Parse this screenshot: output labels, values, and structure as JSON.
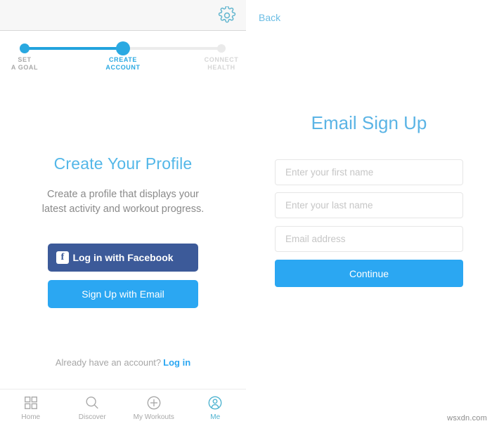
{
  "left_panel": {
    "header": {
      "settings_icon": "gear-icon"
    },
    "stepper": {
      "steps": [
        {
          "label_line1": "SET",
          "label_line2": "A GOAL",
          "state": "complete"
        },
        {
          "label_line1": "CREATE",
          "label_line2": "ACCOUNT",
          "state": "current"
        },
        {
          "label_line1": "CONNECT",
          "label_line2": "HEALTH",
          "state": "upcoming"
        }
      ],
      "active_color": "#2aa9e2",
      "inactive_color": "#eaeaea"
    },
    "title": "Create Your Profile",
    "subtitle_line1": "Create a profile that displays your",
    "subtitle_line2": "latest activity and workout progress.",
    "facebook_button": {
      "label": "Log in with Facebook",
      "icon": "facebook-icon",
      "color": "#3c5a99",
      "badge_letter": "f"
    },
    "email_button": {
      "label": "Sign Up with Email",
      "color": "#2ba7f2"
    },
    "footer": {
      "prompt": "Already have an account?",
      "link": "Log in"
    },
    "tabbar": {
      "items": [
        {
          "label": "Home",
          "icon": "grid-icon",
          "active": false
        },
        {
          "label": "Discover",
          "icon": "search-icon",
          "active": false
        },
        {
          "label": "My Workouts",
          "icon": "plus-circle-icon",
          "active": false
        },
        {
          "label": "Me",
          "icon": "person-circle-icon",
          "active": true
        }
      ],
      "active_color": "#4fb3d0",
      "inactive_color": "#a8a8a8"
    }
  },
  "right_panel": {
    "back_label": "Back",
    "title": "Email Sign Up",
    "fields": [
      {
        "name": "first-name",
        "placeholder": "Enter your first name",
        "value": ""
      },
      {
        "name": "last-name",
        "placeholder": "Enter your last name",
        "value": ""
      },
      {
        "name": "email",
        "placeholder": "Email address",
        "value": ""
      }
    ],
    "continue_button": {
      "label": "Continue",
      "color": "#2ba7f2"
    }
  },
  "watermark": "wsxdn.com"
}
